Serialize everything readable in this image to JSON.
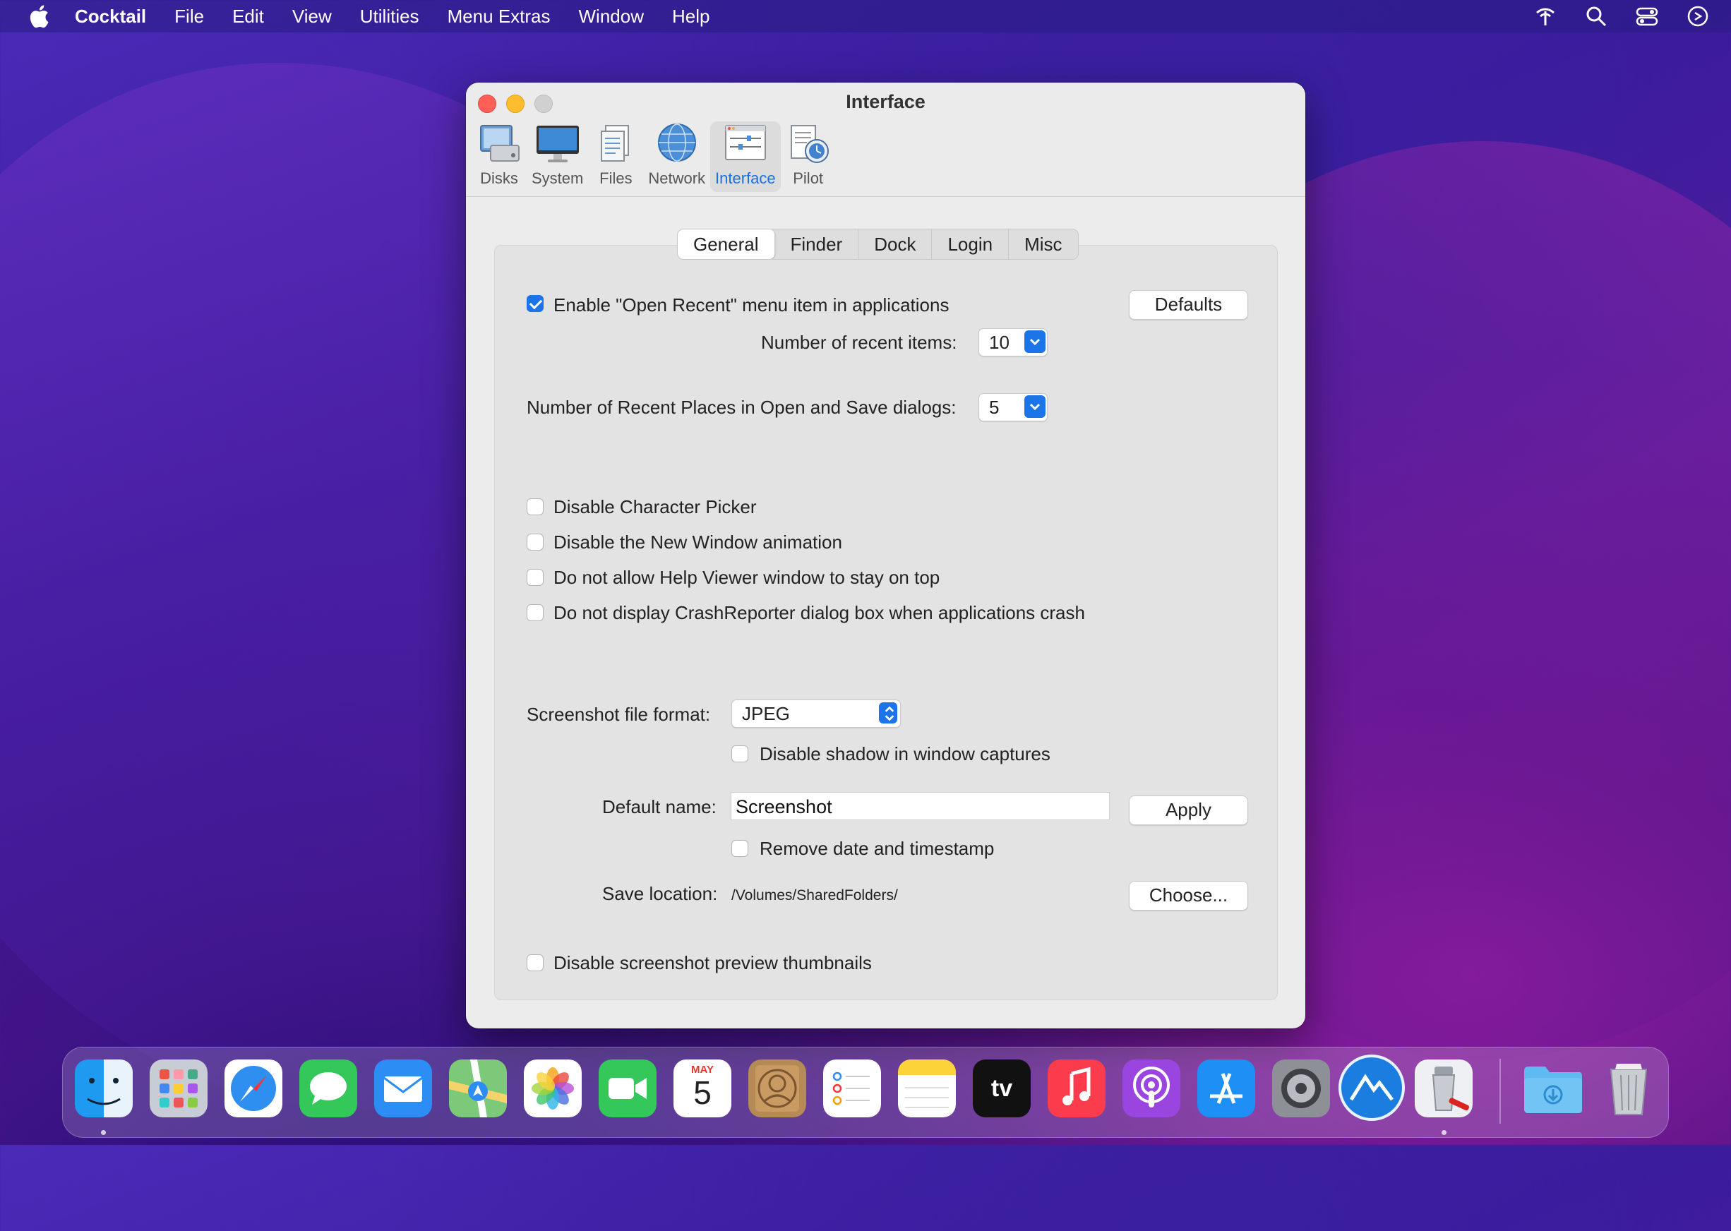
{
  "menubar": {
    "app_name": "Cocktail",
    "items": [
      "File",
      "Edit",
      "View",
      "Utilities",
      "Menu Extras",
      "Window",
      "Help"
    ]
  },
  "window": {
    "title": "Interface",
    "toolbar": [
      {
        "label": "Disks",
        "icon": "disks-icon",
        "selected": false
      },
      {
        "label": "System",
        "icon": "system-icon",
        "selected": false
      },
      {
        "label": "Files",
        "icon": "files-icon",
        "selected": false
      },
      {
        "label": "Network",
        "icon": "network-icon",
        "selected": false
      },
      {
        "label": "Interface",
        "icon": "interface-icon",
        "selected": true
      },
      {
        "label": "Pilot",
        "icon": "pilot-icon",
        "selected": false
      }
    ],
    "tabs": [
      "General",
      "Finder",
      "Dock",
      "Login",
      "Misc"
    ],
    "selected_tab": "General"
  },
  "general": {
    "open_recent": {
      "label": "Enable \"Open Recent\" menu item in applications",
      "checked": true
    },
    "defaults_button": "Defaults",
    "recent_items_label": "Number of recent items:",
    "recent_items_value": "10",
    "recent_places_label": "Number of Recent Places in Open and Save dialogs:",
    "recent_places_value": "5",
    "options": [
      {
        "label": "Disable Character Picker",
        "checked": false
      },
      {
        "label": "Disable the New Window animation",
        "checked": false
      },
      {
        "label": "Do not allow Help Viewer window to stay on top",
        "checked": false
      },
      {
        "label": "Do not display CrashReporter dialog box when applications crash",
        "checked": false
      }
    ],
    "screenshot_format_label": "Screenshot file format:",
    "screenshot_format_value": "JPEG",
    "disable_shadow": {
      "label": "Disable shadow in window captures",
      "checked": false
    },
    "default_name_label": "Default name:",
    "default_name_value": "Screenshot",
    "apply_button": "Apply",
    "remove_timestamp": {
      "label": "Remove date and timestamp",
      "checked": false
    },
    "save_location_label": "Save location:",
    "save_location_value": "/Volumes/SharedFolders/",
    "choose_button": "Choose...",
    "disable_thumbnails": {
      "label": "Disable screenshot preview thumbnails",
      "checked": false
    }
  },
  "dock": {
    "calendar_month": "MAY",
    "calendar_day": "5",
    "tv_label": "tv"
  },
  "colors": {
    "accent": "#1b74e8",
    "selected_label": "#1b6fe0"
  }
}
